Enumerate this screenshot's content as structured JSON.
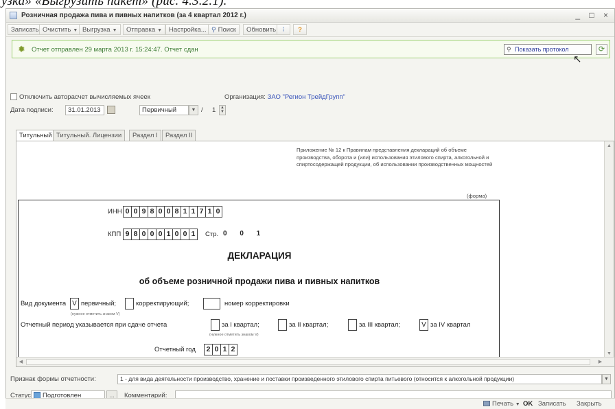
{
  "caption": "узка» «Выгрузить пакет» (рис. 4.3.2.1).",
  "window": {
    "title": "Розничная продажа пива и пивных напитков (за 4 квартал 2012 г.)",
    "controls": "_ □ ×"
  },
  "toolbar": {
    "save": "Записать",
    "clear": "Очистить",
    "export": "Выгрузка",
    "send": "Отправка",
    "settings": "Настройка...",
    "search": "Поиск",
    "refresh": "Обновить",
    "help_icon": "?"
  },
  "notice": {
    "message": "Отчет отправлен 29 марта 2013 г. 15:24:47. Отчет сдан",
    "show_protocol": "Показать протокол"
  },
  "options": {
    "disable_autocalc": "Отключить авторасчет вычисляемых ячеек",
    "org_label": "Организация:",
    "org_value": "ЗАО \"Регион ТрейдГрупп\"",
    "sign_date_label": "Дата подписи:",
    "sign_date": "31.01.2013",
    "doc_kind": "Первичный",
    "page_sep": "/",
    "page_count": "1"
  },
  "tabs": [
    {
      "label": "Титульный"
    },
    {
      "label": "Титульный. Лицензии"
    },
    {
      "label": "Раздел I"
    },
    {
      "label": "Раздел II"
    }
  ],
  "form": {
    "appendix": "Приложение № 12 к Правилам представления деклараций об объеме производства, оборота и (или) использования этилового спирта, алкогольной и спиртосодержащей продукции, об использовании производственных мощностей",
    "forma": "(форма)",
    "inn_label": "ИНН",
    "inn": [
      "0",
      "0",
      "9",
      "8",
      "0",
      "0",
      "8",
      "1",
      "1",
      "7",
      "1",
      "0"
    ],
    "kpp_label": "КПП",
    "kpp": [
      "9",
      "8",
      "0",
      "0",
      "0",
      "1",
      "0",
      "0",
      "1"
    ],
    "page_label": "Стр.",
    "page_num": "0 0 1",
    "title": "ДЕКЛАРАЦИЯ",
    "subtitle": "об объеме розничной продажи пива и пивных напитков",
    "doctype_label": "Вид документа",
    "doctype_mark": "V",
    "primary": "первичный;",
    "corrective": "корректирующий;",
    "correction_num": "номер корректировки",
    "hint": "(нужное отметить знаком V)",
    "period_label": "Отчетный период указывается при сдаче отчета",
    "q1": "за I квартал;",
    "q2": "за II квартал;",
    "q3": "за III квартал;",
    "q4": "за IV квартал",
    "q4_mark": "V",
    "year_label": "Отчетный год",
    "year": [
      "2",
      "0",
      "1",
      "2"
    ]
  },
  "bottom": {
    "form_sign_label": "Признак формы отчетности:",
    "form_sign_value": "1 - для вида деятельности производство, хранение и поставки произведенного этилового спирта питьевого (относится к алкогольной продукции)",
    "status_label": "Статус:",
    "status_value": "Подготовлен",
    "more": "...",
    "comment_label": "Комментарий:"
  },
  "footer": {
    "print": "Печать",
    "ok": "OK",
    "save": "Записать",
    "close": "Закрыть"
  }
}
